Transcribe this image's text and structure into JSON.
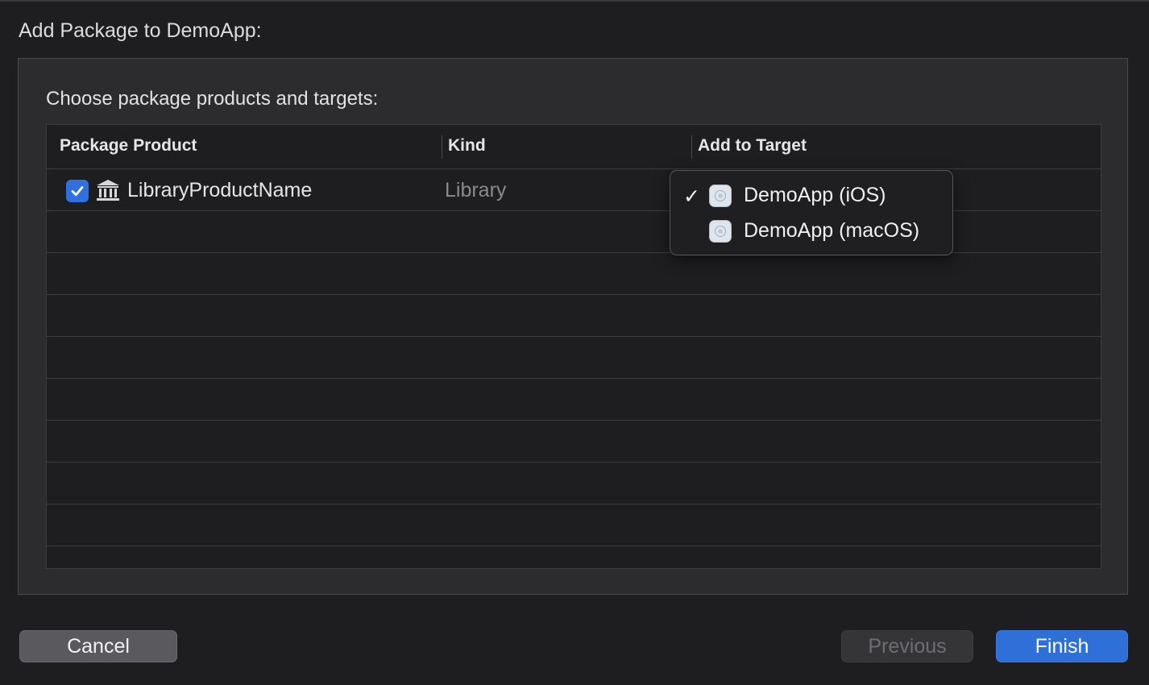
{
  "dialog": {
    "title": "Add Package to DemoApp:"
  },
  "panel": {
    "heading": "Choose package products and targets:"
  },
  "table": {
    "columns": [
      "Package Product",
      "Kind",
      "Add to Target"
    ],
    "rows": [
      {
        "checked": true,
        "icon": "library-icon",
        "product": "LibraryProductName",
        "kind": "Library"
      }
    ]
  },
  "target_menu": {
    "items": [
      {
        "label": "DemoApp (iOS)",
        "checked": true,
        "icon": "app-target-icon"
      },
      {
        "label": "DemoApp (macOS)",
        "checked": false,
        "icon": "app-target-icon"
      }
    ]
  },
  "footer": {
    "cancel_label": "Cancel",
    "previous_label": "Previous",
    "finish_label": "Finish"
  },
  "colors": {
    "accent": "#2f6fd8",
    "background": "#1e1e20",
    "panel": "#2c2c2e"
  }
}
